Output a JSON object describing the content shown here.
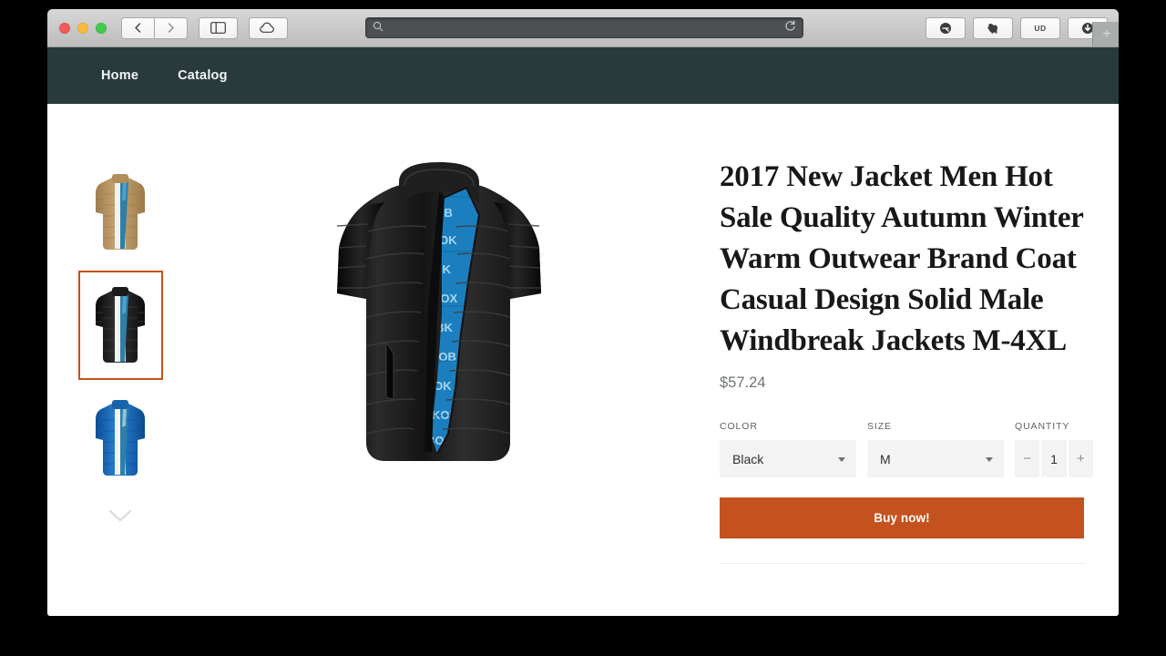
{
  "browser": {
    "traffic_lights": [
      "close",
      "minimize",
      "zoom"
    ],
    "back_label": "Back",
    "forward_label": "Forward",
    "sidebar_label": "Show Sidebar",
    "icloud_label": "iCloud Tabs",
    "url_value": "",
    "url_placeholder": "",
    "reload_label": "Reload",
    "extensions": [
      {
        "name": "evernote-clipper-icon",
        "label": ""
      },
      {
        "name": "elephant-icon",
        "label": ""
      },
      {
        "name": "ud-extension-icon",
        "label": "UD"
      },
      {
        "name": "download-icon",
        "label": ""
      }
    ],
    "new_tab_label": "+"
  },
  "site_nav": {
    "items": [
      {
        "label": "Home"
      },
      {
        "label": "Catalog"
      }
    ]
  },
  "gallery": {
    "thumbnails": [
      {
        "name": "thumbnail-tan-jacket",
        "alt": "Tan puffer jacket",
        "selected": false
      },
      {
        "name": "thumbnail-black-jacket",
        "alt": "Black puffer jacket",
        "selected": true
      },
      {
        "name": "thumbnail-blue-jacket",
        "alt": "Blue puffer jacket",
        "selected": false
      }
    ],
    "more_icon": "chevron-down-icon",
    "main_image_alt": "Black puffer jacket with blue patterned lining"
  },
  "product": {
    "title": "2017 New Jacket Men Hot Sale Quality Autumn Winter Warm Outwear Brand Coat Casual Design Solid Male Windbreak Jackets M-4XL",
    "price": "$57.24",
    "options": {
      "color": {
        "label": "COLOR",
        "value": "Black"
      },
      "size": {
        "label": "SIZE",
        "value": "M"
      },
      "quantity": {
        "label": "QUANTITY",
        "value": "1",
        "minus": "−",
        "plus": "+"
      }
    },
    "buy_label": "Buy now!"
  },
  "colors": {
    "accent": "#c4521f",
    "nav_bg": "#293a3d",
    "page_bg": "#ffffff",
    "desktop_bg": "#000000",
    "field_bg": "#f3f3f3"
  }
}
